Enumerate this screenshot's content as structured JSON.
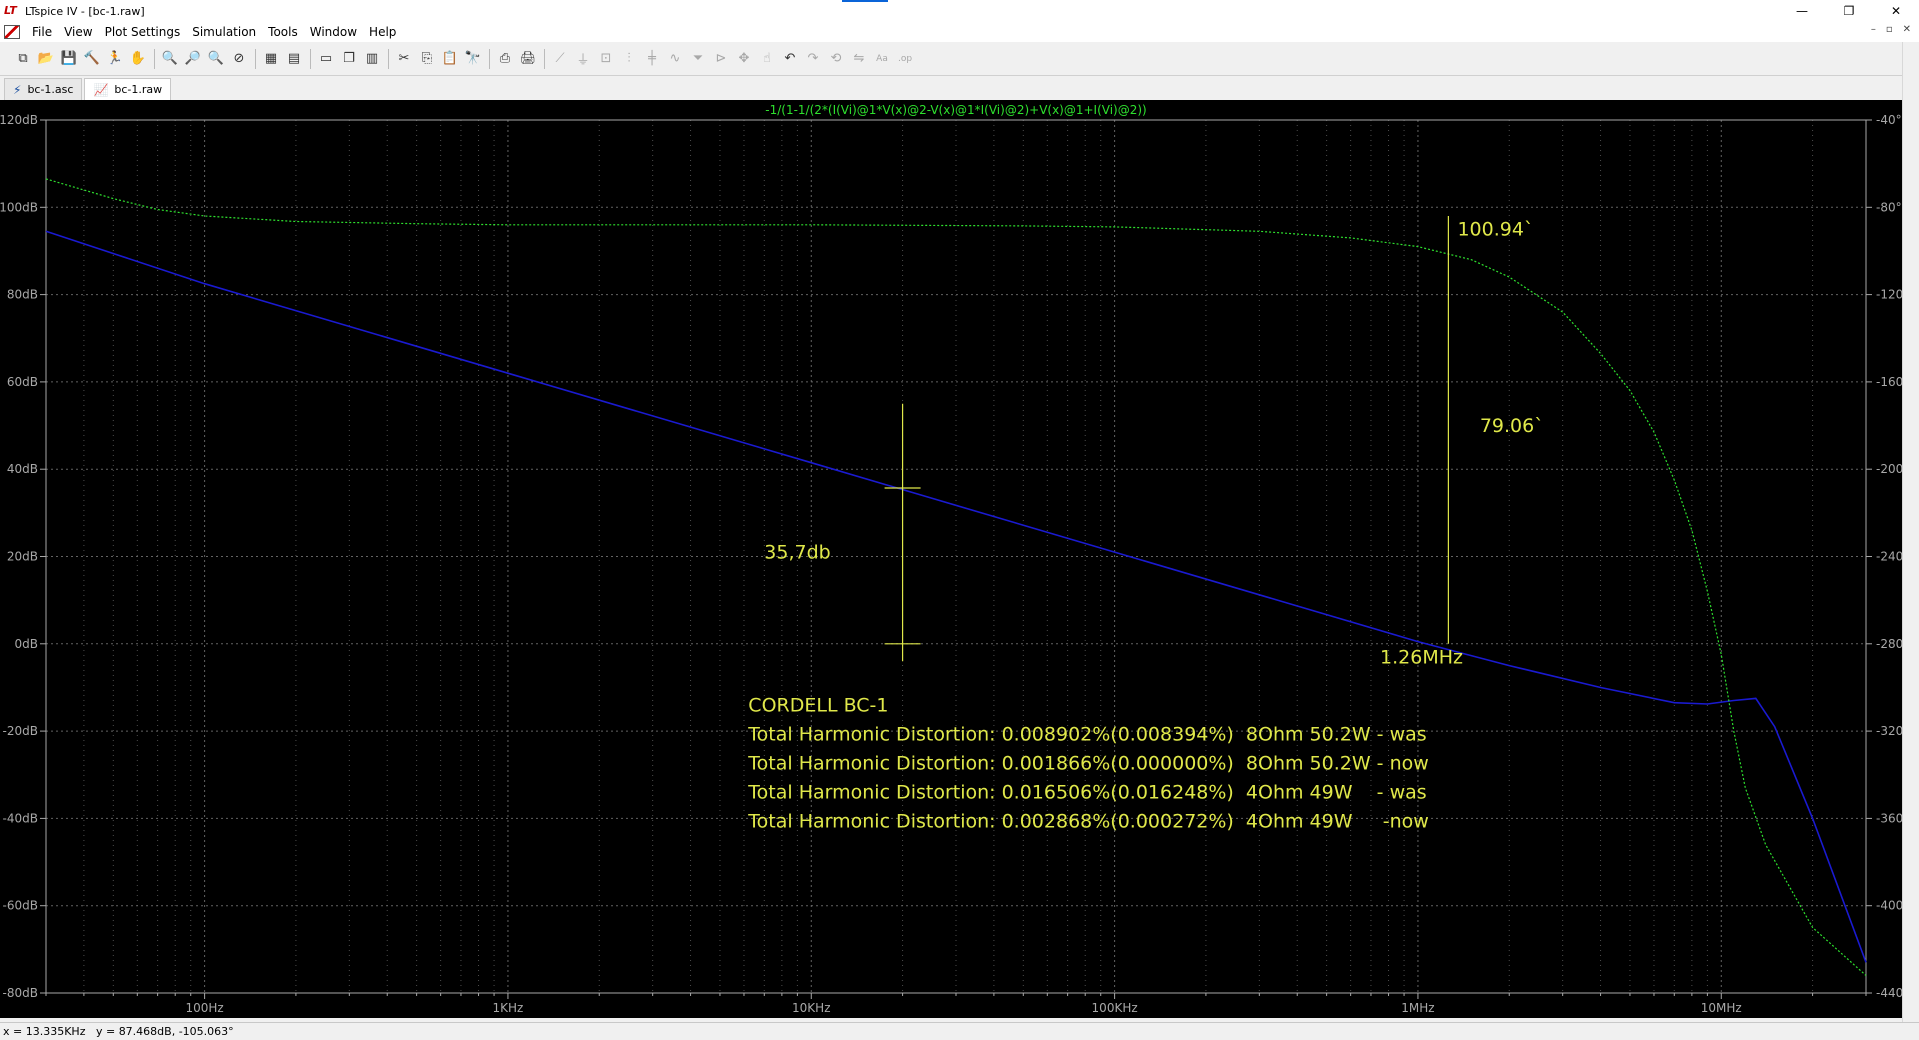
{
  "window": {
    "title": "LTspice IV - [bc-1.raw]",
    "app_logo": "LT",
    "minimize_glyph": "—",
    "maximize_glyph": "❐",
    "close_glyph": "✕"
  },
  "menu": {
    "items": [
      "File",
      "View",
      "Plot Settings",
      "Simulation",
      "Tools",
      "Window",
      "Help"
    ],
    "mdi_minimize": "–",
    "mdi_restore": "▫",
    "mdi_close": "✕"
  },
  "toolbar": {
    "groups": [
      [
        {
          "name": "new-schematic-icon",
          "glyph": "⧉",
          "disabled": false
        },
        {
          "name": "open-icon",
          "glyph": "📂",
          "disabled": false
        },
        {
          "name": "save-icon",
          "glyph": "💾",
          "disabled": false
        },
        {
          "name": "control-panel-icon",
          "glyph": "🔨",
          "disabled": false
        },
        {
          "name": "run-icon",
          "glyph": "🏃",
          "disabled": false
        },
        {
          "name": "halt-icon",
          "glyph": "✋",
          "disabled": true
        }
      ],
      [
        {
          "name": "zoom-in-icon",
          "glyph": "🔍",
          "disabled": false
        },
        {
          "name": "pan-icon",
          "glyph": "🔎",
          "disabled": false
        },
        {
          "name": "zoom-out-icon",
          "glyph": "🔍",
          "disabled": false
        },
        {
          "name": "zoom-fit-icon",
          "glyph": "⊘",
          "disabled": false
        }
      ],
      [
        {
          "name": "autorange-icon",
          "glyph": "▦",
          "disabled": false
        },
        {
          "name": "pick-visible-traces-icon",
          "glyph": "▤",
          "disabled": false
        }
      ],
      [
        {
          "name": "tile-horizontal-icon",
          "glyph": "▭",
          "disabled": false
        },
        {
          "name": "cascade-icon",
          "glyph": "❐",
          "disabled": false
        },
        {
          "name": "tile-vertical-icon",
          "glyph": "▥",
          "disabled": false
        }
      ],
      [
        {
          "name": "cut-icon",
          "glyph": "✂",
          "disabled": false
        },
        {
          "name": "copy-icon",
          "glyph": "⎘",
          "disabled": false
        },
        {
          "name": "paste-icon",
          "glyph": "📋",
          "disabled": false
        },
        {
          "name": "find-icon",
          "glyph": "🔭",
          "disabled": false
        }
      ],
      [
        {
          "name": "print-setup-icon",
          "glyph": "⎙",
          "disabled": false
        },
        {
          "name": "print-icon",
          "glyph": "🖨",
          "disabled": false
        }
      ],
      [
        {
          "name": "draw-wire-icon",
          "glyph": "⟋",
          "disabled": true
        },
        {
          "name": "ground-icon",
          "glyph": "⏚",
          "disabled": true
        },
        {
          "name": "label-net-icon",
          "glyph": "⊡",
          "disabled": true
        },
        {
          "name": "resistor-icon",
          "glyph": "⫶",
          "disabled": true
        },
        {
          "name": "capacitor-icon",
          "glyph": "╪",
          "disabled": true
        },
        {
          "name": "inductor-icon",
          "glyph": "∿",
          "disabled": true
        },
        {
          "name": "diode-icon",
          "glyph": "⏷",
          "disabled": true
        },
        {
          "name": "component-icon",
          "glyph": "⊳",
          "disabled": true
        },
        {
          "name": "move-icon",
          "glyph": "✥",
          "disabled": true
        },
        {
          "name": "drag-icon",
          "glyph": "☝",
          "disabled": true
        },
        {
          "name": "undo-icon",
          "glyph": "↶",
          "disabled": false
        },
        {
          "name": "redo-icon",
          "glyph": "↷",
          "disabled": true
        },
        {
          "name": "rotate-icon",
          "glyph": "⟲",
          "disabled": true
        },
        {
          "name": "mirror-icon",
          "glyph": "⇋",
          "disabled": true
        },
        {
          "name": "text-icon",
          "glyph": "Aa",
          "disabled": true
        },
        {
          "name": "spice-directive-icon",
          "glyph": ".op",
          "disabled": true
        }
      ]
    ]
  },
  "tabs": [
    {
      "label": "bc-1.asc",
      "icon": "schematic-icon",
      "glyph": "⚡",
      "active": false
    },
    {
      "label": "bc-1.raw",
      "icon": "waveform-icon",
      "glyph": "📈",
      "active": true
    }
  ],
  "plot": {
    "trace_expression": "-1/(1-1/(2*(I(Vi)@1*V(x)@2-V(x)@1*I(Vi)@2)+V(x)@1+I(Vi)@2))",
    "colors": {
      "background": "#000000",
      "grid": "#6e6e6e",
      "axis_text": "#a8a8a8",
      "magnitude_trace": "#1a1ad0",
      "phase_trace": "#2ee02e",
      "annotation": "#e0e84a",
      "expression_text": "#2ee02e"
    }
  },
  "chart_data": {
    "type": "line",
    "title": "-1/(1-1/(2*(I(Vi)@1*V(x)@2-V(x)@1*I(Vi)@2)+V(x)@1+I(Vi)@2))",
    "x_scale": "log",
    "xlim": [
      30,
      30000000
    ],
    "x_tick_values": [
      100,
      1000,
      10000,
      100000,
      1000000,
      10000000
    ],
    "x_tick_labels": [
      "100Hz",
      "1KHz",
      "10KHz",
      "100KHz",
      "1MHz",
      "10MHz"
    ],
    "ylim_left": [
      -80,
      120
    ],
    "y_left_tick_values": [
      120,
      100,
      80,
      60,
      40,
      20,
      0,
      -20,
      -40,
      -60,
      -80
    ],
    "y_left_tick_labels": [
      "120dB",
      "100dB",
      "80dB",
      "60dB",
      "40dB",
      "20dB",
      "0dB",
      "-20dB",
      "-40dB",
      "-60dB",
      "-80dB"
    ],
    "ylim_right": [
      -440,
      -40
    ],
    "y_right_tick_values": [
      -40,
      -80,
      -120,
      -160,
      -200,
      -240,
      -280,
      -320,
      -360,
      -400,
      -440
    ],
    "y_right_tick_labels": [
      "-40°",
      "-80°",
      "-120°",
      "-160°",
      "-200°",
      "-240°",
      "-280°",
      "-320°",
      "-360°",
      "-400°",
      "-440°"
    ],
    "grid": true,
    "series": [
      {
        "axis": "left",
        "style": "solid",
        "x": [
          30,
          100,
          1000,
          10000,
          100000,
          1000000,
          2000000,
          4000000,
          7000000,
          9000000,
          11000000,
          13000000,
          15000000,
          20000000,
          30000000
        ],
        "y": [
          94.5,
          82.5,
          62,
          41.5,
          21,
          0.5,
          -5,
          -10,
          -13.5,
          -13.8,
          -13,
          -12.5,
          -19,
          -40,
          -73
        ]
      },
      {
        "axis": "right",
        "style": "dotted",
        "x": [
          30,
          50,
          70,
          100,
          200,
          500,
          1000,
          5000,
          10000,
          50000,
          100000,
          300000,
          600000,
          1000000,
          1500000,
          2000000,
          3000000,
          4000000,
          5000000,
          6000000,
          7000000,
          8000000,
          9000000,
          10000000,
          11000000,
          12000000,
          14000000,
          20000000,
          30000000
        ],
        "y": [
          -67,
          -76,
          -81,
          -84,
          -86.5,
          -87.5,
          -88,
          -88,
          -88,
          -88.5,
          -89,
          -91,
          -94,
          -98,
          -104,
          -112,
          -128,
          -147,
          -164,
          -183,
          -205,
          -228,
          -256,
          -285,
          -320,
          -346,
          -372,
          -410,
          -432
        ]
      }
    ],
    "annotations": [
      {
        "text": "100.94`",
        "x": 1350000,
        "y": 93.5
      },
      {
        "text": "79.06`",
        "x": 1600000,
        "y": 48.5
      },
      {
        "text": "35,7db",
        "x": 7000,
        "y": 19.5
      },
      {
        "text": "1.26MHz",
        "x": 750000,
        "y": -4.5
      }
    ],
    "measure_lines": [
      {
        "x": 20000,
        "y_top": 55,
        "y_bottom": -4,
        "tick_y": [
          35.7,
          0
        ]
      },
      {
        "x": 1260000,
        "y_top": 98,
        "y_bottom": 0
      }
    ],
    "notes": [
      "CORDELL BC-1",
      "Total Harmonic Distortion: 0.008902%(0.008394%)  8Ohm 50.2W - was",
      "Total Harmonic Distortion: 0.001866%(0.000000%)  8Ohm 50.2W - now",
      "Total Harmonic Distortion: 0.016506%(0.016248%)  4Ohm 49W    - was",
      "Total Harmonic Distortion: 0.002868%(0.000272%)  4Ohm 49W     -now"
    ],
    "notes_anchor": {
      "x": 6200,
      "y": -15.5
    }
  },
  "status": {
    "x_readout": "x = 13.335KHz",
    "y_readout": "y = 87.468dB, -105.063°"
  }
}
